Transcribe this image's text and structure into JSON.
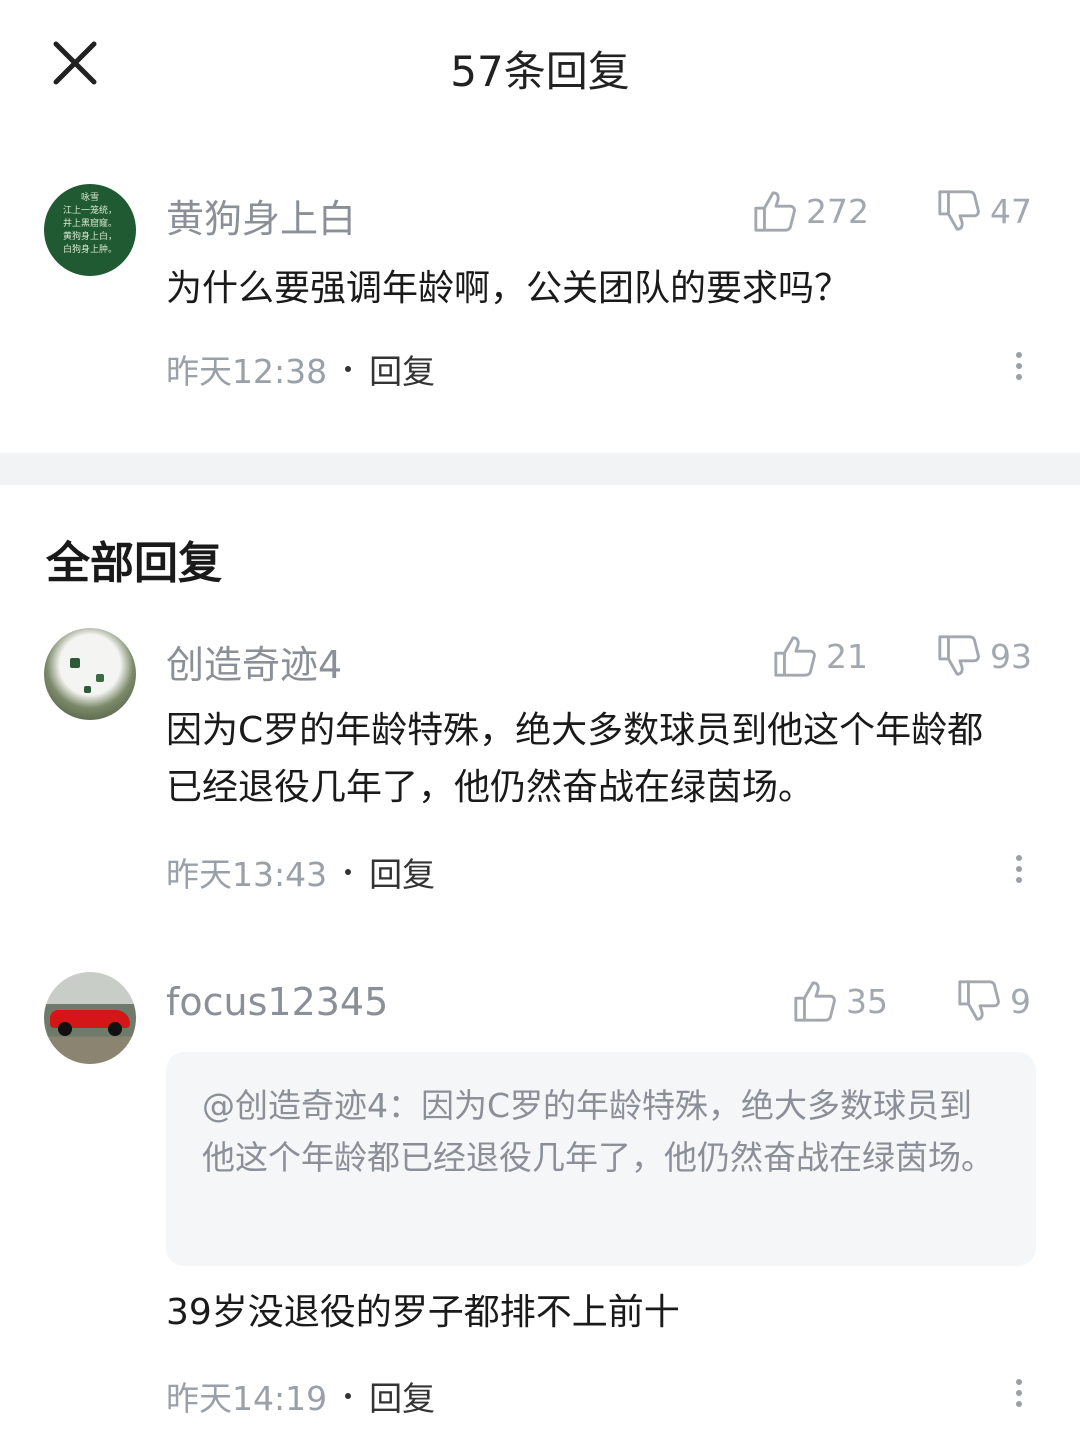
{
  "header": {
    "title": "57条回复",
    "close_icon": "close-icon"
  },
  "main_comment": {
    "username": "黄狗身上白",
    "avatar_lines": [
      "咏雪",
      "江上一笼统，",
      "井上黑窟窿。",
      "黄狗身上白，",
      "白狗身上肿。"
    ],
    "likes": "272",
    "dislikes": "47",
    "text": "为什么要强调年龄啊，公关团队的要求吗？",
    "time": "昨天12:38",
    "reply_label": "回复"
  },
  "section": {
    "title": "全部回复"
  },
  "replies": [
    {
      "username": "创造奇迹4",
      "likes": "21",
      "dislikes": "93",
      "text": "因为C罗的年龄特殊，绝大多数球员到他这个年龄都已经退役几年了，他仍然奋战在绿茵场。",
      "time": "昨天13:43",
      "reply_label": "回复"
    },
    {
      "username": "focus12345",
      "likes": "35",
      "dislikes": "9",
      "quote": "@创造奇迹4：因为C罗的年龄特殊，绝大多数球员到他这个年龄都已经退役几年了，他仍然奋战在绿茵场。",
      "text": "39岁没退役的罗子都排不上前十",
      "time": "昨天14:19",
      "reply_label": "回复"
    }
  ],
  "colors": {
    "meta_gray": "#9aa0a8",
    "divider": "#f2f3f5",
    "quote_bg": "#f5f6f8"
  }
}
